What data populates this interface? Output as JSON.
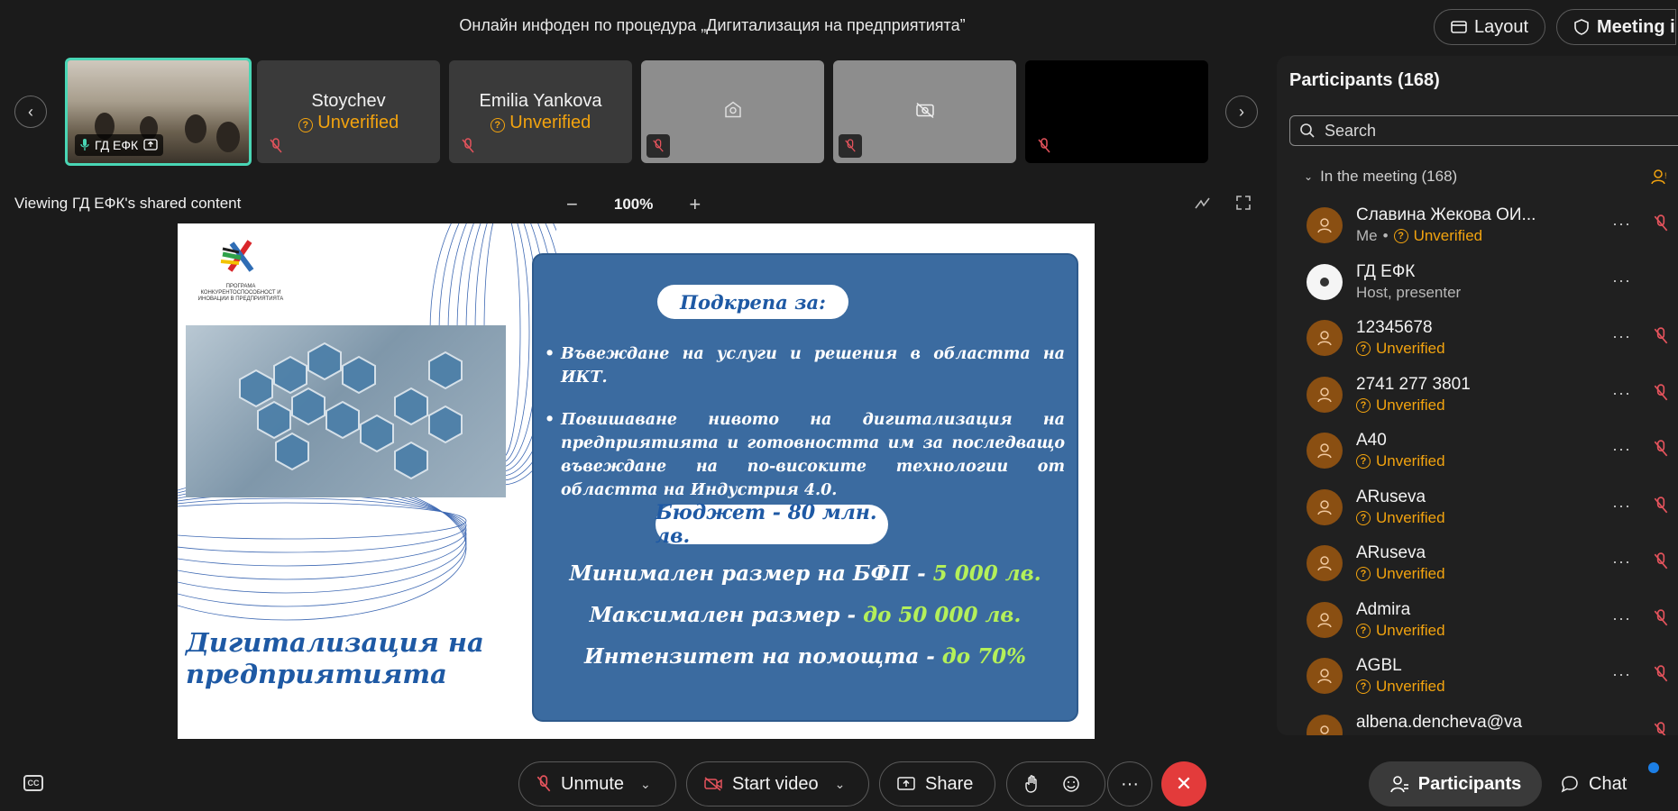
{
  "header": {
    "meeting_title": "Онлайн инфоден по процедура „Дигитализация на предприятията”",
    "layout_label": "Layout",
    "meeting_info_label": "Meeting i"
  },
  "filmstrip": {
    "tiles": [
      {
        "name": "ГД ЕФК",
        "type": "video",
        "active": true
      },
      {
        "name": "Stoychev",
        "status": "Unverified"
      },
      {
        "name": "Emilia Yankova",
        "status": "Unverified"
      },
      {
        "name": "",
        "type": "gray",
        "icon": "avatar-placeholder-icon"
      },
      {
        "name": "",
        "type": "gray",
        "icon": "camera-off-icon"
      },
      {
        "name": "",
        "type": "black"
      }
    ]
  },
  "share": {
    "viewing_label": "Viewing ГД ЕФК's shared content",
    "zoom_value": "100%",
    "zoom_minus": "−",
    "zoom_plus": "+"
  },
  "slide": {
    "logo_text_line1": "ПРОГРАМА",
    "logo_text_line2": "КОНКУРЕНТОСПОСОБНОСТ И",
    "logo_text_line3": "ИНОВАЦИИ В ПРЕДПРИЯТИЯТА",
    "title_line1": "Дигитализация на",
    "title_line2": "предприятията",
    "support_label": "Подкрепа за:",
    "bullet1": "Въвеждане на услуги и решения в областта на ИКТ.",
    "bullet2": "Повишаване нивото на дигитализация на предприятията и готовността им за последващо въвеждане на по-високите технологии от областта на Индустрия 4.0.",
    "budget_label": "Бюджет - 80 млн. лв.",
    "min_text": "Минимален размер на БФП - ",
    "min_value": "5 000 лв.",
    "max_text": "Максимален размер - ",
    "max_value": "до 50 000 лв.",
    "intensity_text": "Интензитет на помощта - ",
    "intensity_value": "до 70%"
  },
  "participants_panel": {
    "title": "Participants (168)",
    "search_placeholder": "Search",
    "section_label": "In the meeting (168)",
    "list": [
      {
        "name": "Славина Жекова ОИ...",
        "prefix": "Me",
        "status": "Unverified",
        "muted": true
      },
      {
        "name": "ГД ЕФК",
        "role": "Host, presenter",
        "muted": false,
        "avatar": "white"
      },
      {
        "name": "12345678",
        "status": "Unverified",
        "muted": true
      },
      {
        "name": "2741 277 3801",
        "status": "Unverified",
        "muted": true
      },
      {
        "name": "A40",
        "status": "Unverified",
        "muted": true
      },
      {
        "name": "ARuseva",
        "status": "Unverified",
        "muted": true
      },
      {
        "name": "ARuseva",
        "status": "Unverified",
        "muted": true
      },
      {
        "name": "Admira",
        "status": "Unverified",
        "muted": true
      },
      {
        "name": "AGBL",
        "status": "Unverified",
        "muted": true
      },
      {
        "name": "albena.dencheva@va",
        "status": "",
        "muted": true
      }
    ]
  },
  "controls": {
    "cc_label": "CC",
    "unmute_label": "Unmute",
    "start_video_label": "Start video",
    "share_label": "Share",
    "more_label": "···",
    "participants_label": "Participants",
    "chat_label": "Chat"
  },
  "colors": {
    "accent_active": "#49d6b5",
    "unverified": "#f2a30f",
    "end_call": "#e33b3b",
    "mute_red": "#e4535c",
    "slide_blue": "#3b6ba0",
    "highlight_green": "#b4f05a"
  }
}
